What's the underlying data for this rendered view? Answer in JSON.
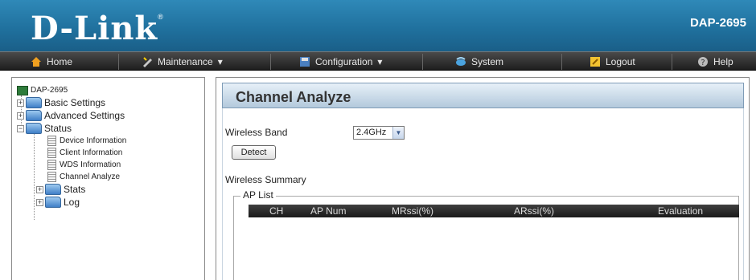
{
  "header": {
    "logo_text": "D-Link",
    "logo_mark": "®",
    "model": "DAP-2695"
  },
  "nav": [
    {
      "label": "Home",
      "icon": "home-icon",
      "has_dropdown": false
    },
    {
      "label": "Maintenance",
      "icon": "tools-icon",
      "has_dropdown": true
    },
    {
      "label": "Configuration",
      "icon": "disk-icon",
      "has_dropdown": true
    },
    {
      "label": "System",
      "icon": "system-icon",
      "has_dropdown": false
    },
    {
      "label": "Logout",
      "icon": "logout-icon",
      "has_dropdown": false
    },
    {
      "label": "Help",
      "icon": "help-icon",
      "has_dropdown": false
    }
  ],
  "nav_dropdown_glyph": "▾",
  "tree": {
    "root": "DAP-2695",
    "basic": "Basic Settings",
    "advanced": "Advanced Settings",
    "status": "Status",
    "device_info": "Device Information",
    "client_info": "Client Information",
    "wds_info": "WDS Information",
    "channel_analyze": "Channel Analyze",
    "stats": "Stats",
    "log": "Log",
    "expand_glyph": "+",
    "collapse_glyph": "−"
  },
  "main": {
    "title": "Channel Analyze",
    "wireless_band_label": "Wireless Band",
    "wireless_band_value": "2.4GHz",
    "detect_button": "Detect",
    "wireless_summary_label": "Wireless Summary",
    "ap_list_legend": "AP List",
    "columns": [
      "CH",
      "AP Num",
      "MRssi(%)",
      "ARssi(%)",
      "Evaluation"
    ],
    "rows": []
  },
  "colors": {
    "header_blue": "#2f89b8",
    "navbar_dark": "#2b2b2b",
    "title_bar": "#b3c9dc"
  }
}
